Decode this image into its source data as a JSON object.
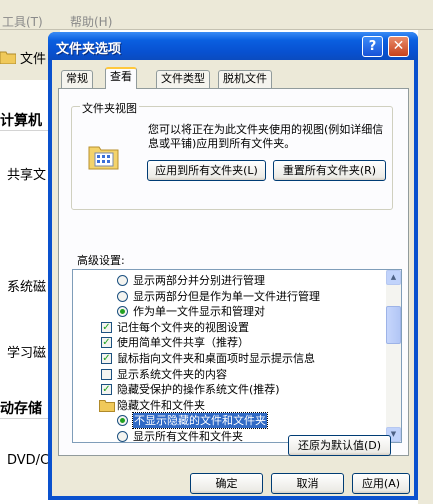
{
  "background": {
    "menu": {
      "tools": "工具(T)",
      "help": "帮助(H)"
    },
    "tab_label": "文件",
    "pane_items": [
      "计算机",
      "共享文",
      "系统磁",
      "学习磁",
      "动存储",
      "DVD/C"
    ]
  },
  "dialog": {
    "title": "文件夹选项",
    "help_btn": "?",
    "close_btn": "✕",
    "tabs": [
      "常规",
      "查看",
      "文件类型",
      "脱机文件"
    ],
    "view_group": {
      "label": "文件夹视图",
      "description": "您可以将正在为此文件夹使用的视图(例如详细信息或平铺)应用到所有文件夹。",
      "apply_all": "应用到所有文件夹(L)",
      "reset_all": "重置所有文件夹(R)"
    },
    "advanced_label": "高级设置:",
    "advanced_items": [
      {
        "type": "radio",
        "checked": false,
        "indent": 2,
        "label": "显示两部分并分别进行管理"
      },
      {
        "type": "radio",
        "checked": false,
        "indent": 2,
        "label": "显示两部分但是作为单一文件进行管理"
      },
      {
        "type": "radio",
        "checked": true,
        "indent": 2,
        "label": "作为单一文件显示和管理对"
      },
      {
        "type": "check",
        "checked": true,
        "indent": 1,
        "label": "记住每个文件夹的视图设置"
      },
      {
        "type": "check",
        "checked": true,
        "indent": 1,
        "label": "使用简单文件共享（推荐）"
      },
      {
        "type": "check",
        "checked": true,
        "indent": 1,
        "label": "鼠标指向文件夹和桌面项时显示提示信息"
      },
      {
        "type": "check",
        "checked": false,
        "indent": 1,
        "label": "显示系统文件夹的内容"
      },
      {
        "type": "check",
        "checked": true,
        "indent": 1,
        "label": "隐藏受保护的操作系统文件(推荐)"
      },
      {
        "type": "folder",
        "checked": false,
        "indent": 1,
        "label": "隐藏文件和文件夹"
      },
      {
        "type": "radio",
        "checked": true,
        "indent": 2,
        "label": "不显示隐藏的文件和文件夹",
        "selected": true
      },
      {
        "type": "radio",
        "checked": false,
        "indent": 2,
        "label": "显示所有文件和文件夹"
      }
    ],
    "restore_defaults": "还原为默认值(D)",
    "footer": {
      "ok": "确定",
      "cancel": "取消",
      "apply": "应用(A)"
    }
  }
}
